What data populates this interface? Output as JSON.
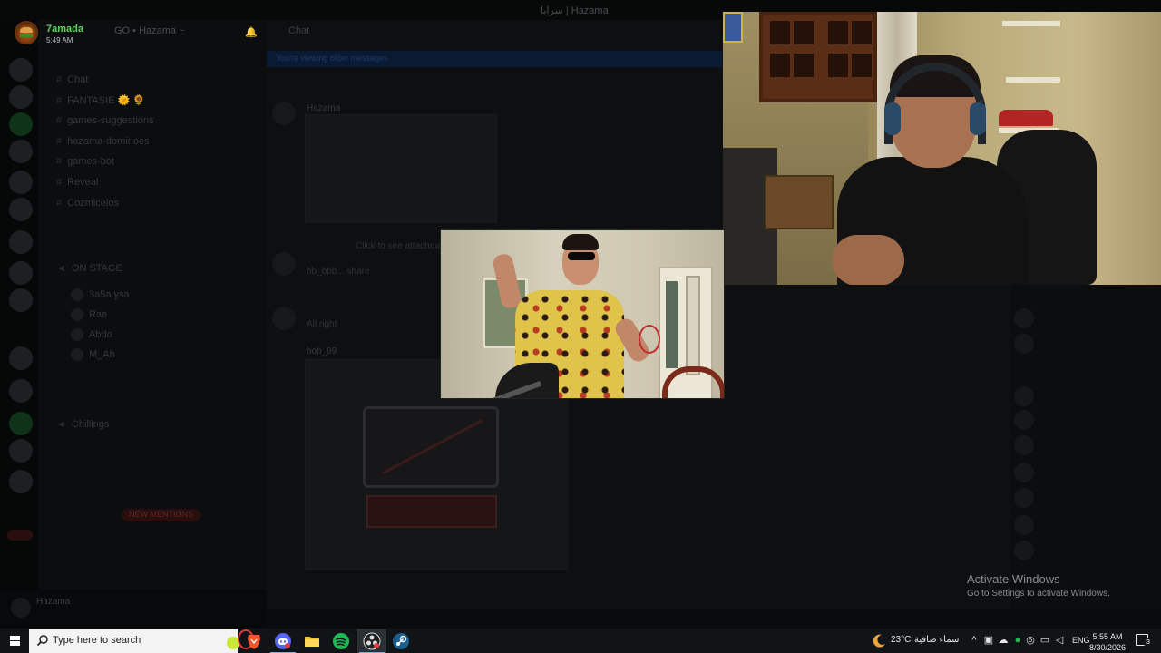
{
  "window": {
    "title": "سرايا | Hazama"
  },
  "notification": {
    "name": "7amada",
    "time": "5:49 AM"
  },
  "discord": {
    "server_name": "GO • Hazama ~",
    "channels": [
      {
        "label": "Chat"
      },
      {
        "label": "FANTASIE 🌞 🌻"
      },
      {
        "label": "games-suggestions"
      },
      {
        "label": "hazama-dominoes"
      },
      {
        "label": "games-bot"
      },
      {
        "label": "Reveal"
      },
      {
        "label": "Cozmicelos"
      },
      {
        "label": "ON STAGE"
      },
      {
        "label": "Chillings"
      }
    ],
    "voice_users": [
      "3a5a ysa",
      "Rae",
      "Abdo",
      "M_Ah"
    ],
    "new_mentions": "NEW MENTIONS",
    "chat_header": "Chat",
    "banner_text": "You're viewing older messages",
    "messages": [
      {
        "author": "Hazama",
        "text": ""
      },
      {
        "author": "",
        "text": "Click to see attachment"
      },
      {
        "author": "",
        "text": "bb_bbb... share"
      },
      {
        "author": "",
        "text": "All right"
      },
      {
        "author": "bob_99",
        "text": ""
      }
    ],
    "user": "Hazama"
  },
  "watermark": {
    "title": "Activate Windows",
    "subtitle": "Go to Settings to activate Windows."
  },
  "taskbar": {
    "search_placeholder": "Type here to search",
    "weather_temp": "23°C",
    "weather_desc": "سماء صافية",
    "language": "ENG",
    "time": "5:55 AM",
    "date": "8/30/2026",
    "notification_count": "3",
    "apps": [
      "brave-icon",
      "discord-icon",
      "file-explorer-icon",
      "spotify-icon",
      "obs-icon",
      "steam-icon"
    ]
  },
  "colors": {
    "accent_green": "#5cd65c",
    "taskbar_bg": "#101417",
    "spotify": "#1db954",
    "brave": "#fb542b",
    "steam": "#1b5f8f"
  }
}
